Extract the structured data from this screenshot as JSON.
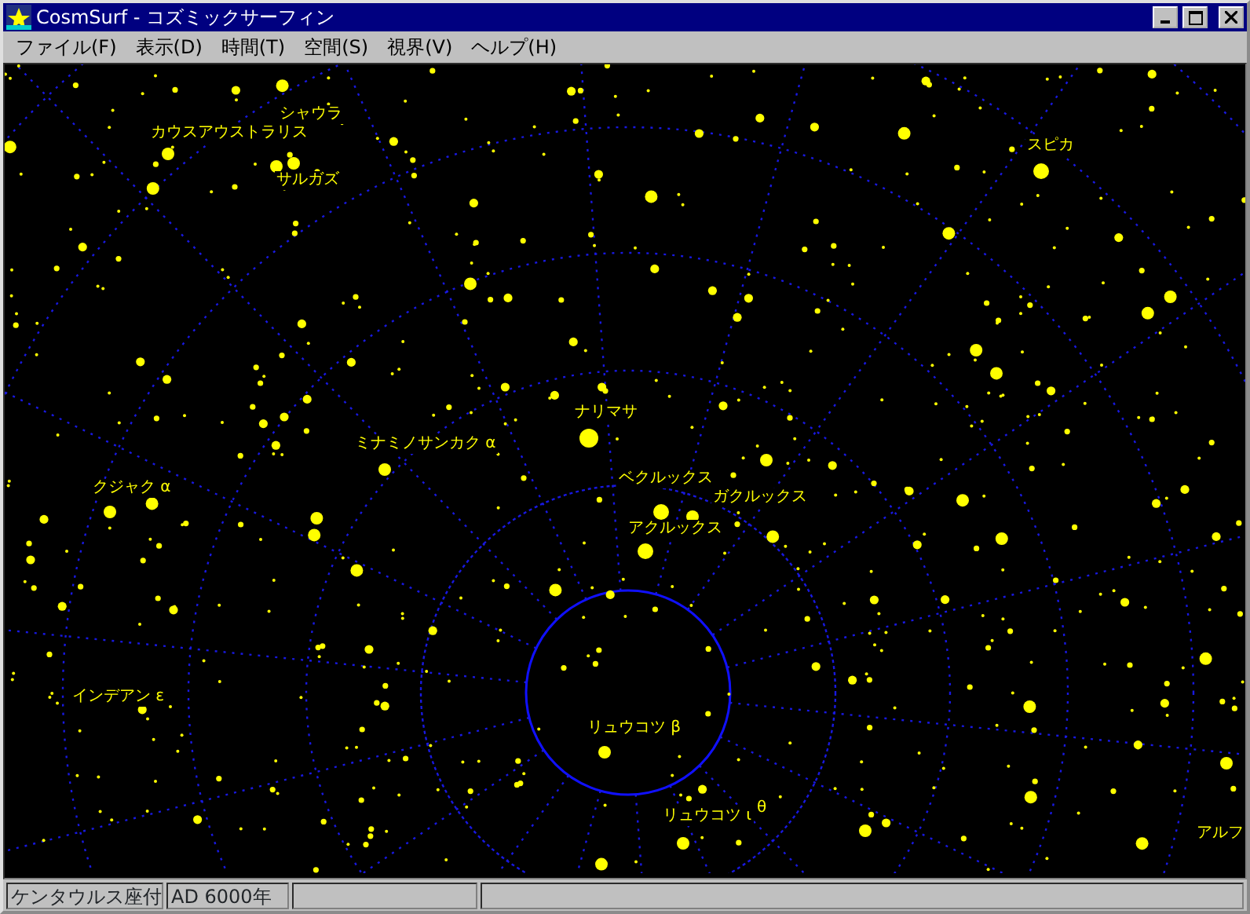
{
  "window": {
    "title": "CosmSurf - コズミックサーフィン"
  },
  "menu": [
    "ファイル(F)",
    "表示(D)",
    "時間(T)",
    "空間(S)",
    "視界(V)",
    "ヘルプ(H)"
  ],
  "star_labels": [
    "シャウラ",
    "カウスアウストラリス",
    "サルガズ",
    "スピカ",
    "ナリマサ",
    "ミナミノサンカク α",
    "ベクルックス",
    "ガクルックス",
    "アクルックス",
    "クジャク α",
    "インデアン ε",
    "リュウコツ β",
    "リュウコツ ι",
    "θ",
    "アルフ"
  ],
  "status_bar": [
    "ケンタウルス座付",
    "AD 6000年"
  ]
}
